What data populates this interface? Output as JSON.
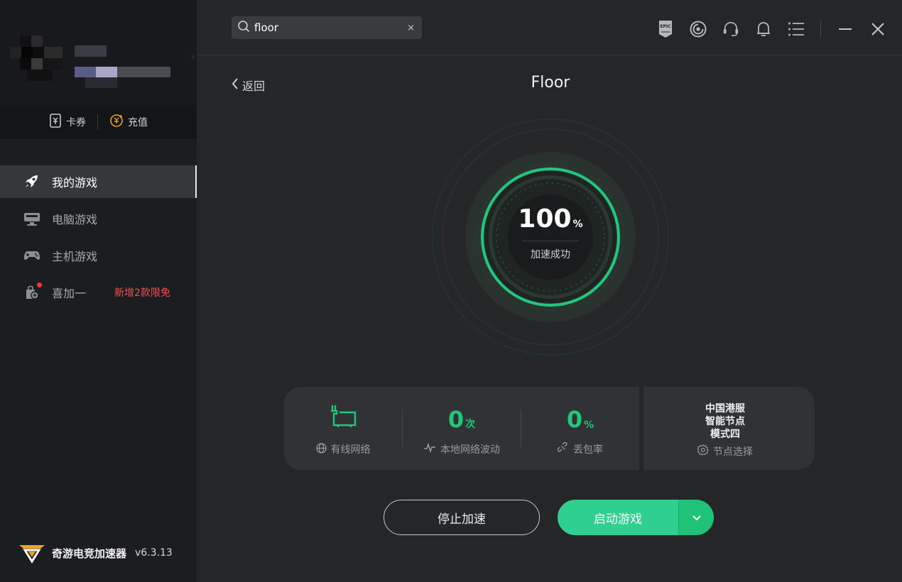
{
  "wallet": {
    "coupon_label": "卡券",
    "recharge_label": "充值"
  },
  "nav": {
    "my_games": "我的游戏",
    "pc_games": "电脑游戏",
    "console_games": "主机游戏",
    "freebies": "喜加一",
    "freebies_promo": "新增2款限免"
  },
  "brand": {
    "name": "奇游电竞加速器",
    "version": "v6.3.13"
  },
  "search": {
    "value": "floor",
    "clear": "×"
  },
  "header_icons": [
    "epic-icon",
    "ubisoft-icon",
    "headset-icon",
    "bell-icon",
    "menu-icon",
    "minimize-icon",
    "close-icon"
  ],
  "page": {
    "back_label": "返回",
    "title": "Floor"
  },
  "gauge": {
    "value": "100",
    "unit": "%",
    "status": "加速成功",
    "progress": 1.0
  },
  "stats": {
    "network_type": "有线网络",
    "jitter_value": "0",
    "jitter_unit": "次",
    "jitter_label": "本地网络波动",
    "loss_value": "0",
    "loss_unit": "%",
    "loss_label": "丢包率"
  },
  "node": {
    "line1": "中国港服",
    "line2": "智能节点",
    "line3": "模式四",
    "select_label": "节点选择"
  },
  "buttons": {
    "stop": "停止加速",
    "launch": "启动游戏"
  },
  "colors": {
    "accent": "#21c77a",
    "accent_light": "#2fd08f",
    "promo": "#f0514e",
    "sidebar_bg": "#1c1d20",
    "main_bg": "#252628"
  }
}
